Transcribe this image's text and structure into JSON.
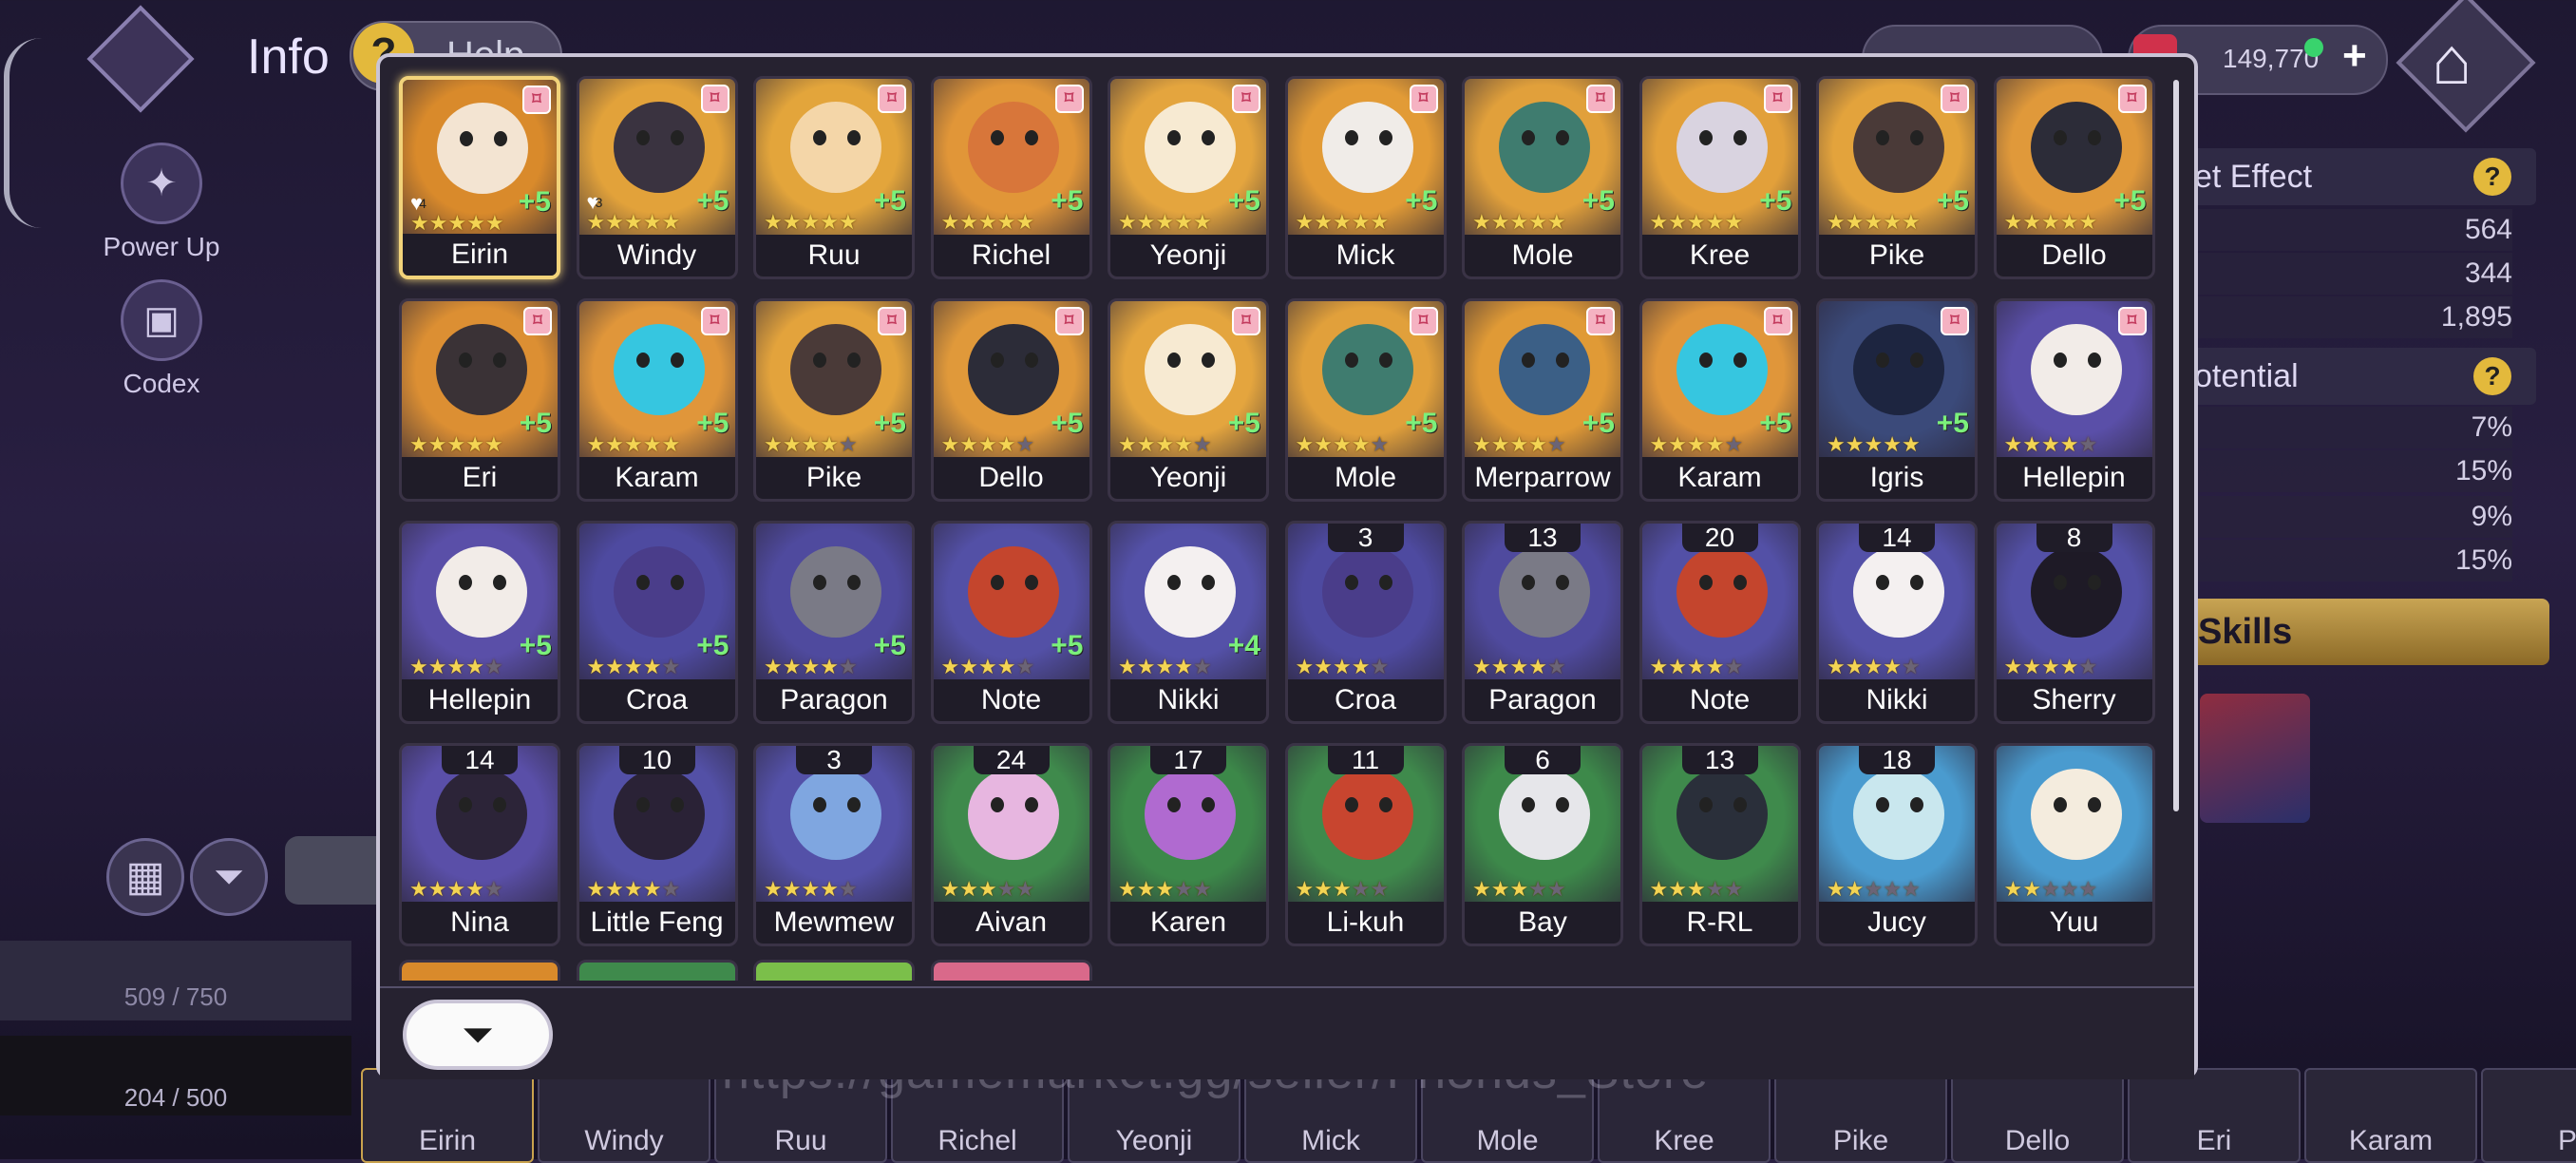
{
  "screen": {
    "title": "Info",
    "help_label": "Help",
    "side_nav": [
      {
        "label": "Power Up",
        "icon": "power-up-icon"
      },
      {
        "label": "Codex",
        "icon": "codex-icon"
      }
    ],
    "currency": {
      "value": "149,770",
      "plus": "+"
    },
    "right_panel": {
      "set_effect_label": "et Effect",
      "set_stats": [
        "564",
        "344",
        "1,895"
      ],
      "potential_label": "otential",
      "potential_stats": [
        "7%",
        "15%",
        "9%",
        "15%"
      ],
      "skills_label": "Skills"
    },
    "capacity": [
      {
        "label": "509 / 750"
      },
      {
        "label": "204 / 500"
      }
    ],
    "bottom_strip": [
      "Eirin",
      "Windy",
      "Ruu",
      "Richel",
      "Yeonji",
      "Mick",
      "Mole",
      "Kree",
      "Pike",
      "Dello",
      "Eri",
      "Karam",
      "P"
    ],
    "watermark": "https://gamemarket.gg/seller/Fri3nds_Store"
  },
  "modal": {
    "cards": [
      {
        "name": "Eirin",
        "stars": 5,
        "plus": "+5",
        "count": "",
        "heart": "4",
        "selected": true,
        "lock": true,
        "bg": "#d98a2b",
        "face": "#f3e4d2"
      },
      {
        "name": "Windy",
        "stars": 5,
        "plus": "+5",
        "count": "",
        "heart": "3",
        "selected": false,
        "lock": true,
        "bg": "#e2a23a",
        "face": "#3a3340"
      },
      {
        "name": "Ruu",
        "stars": 5,
        "plus": "+5",
        "count": "",
        "heart": "",
        "selected": false,
        "lock": true,
        "bg": "#e3a53b",
        "face": "#f4d6a8"
      },
      {
        "name": "Richel",
        "stars": 5,
        "plus": "+5",
        "count": "",
        "heart": "",
        "selected": false,
        "lock": true,
        "bg": "#e19638",
        "face": "#d8763a"
      },
      {
        "name": "Yeonji",
        "stars": 5,
        "plus": "+5",
        "count": "",
        "heart": "",
        "selected": false,
        "lock": true,
        "bg": "#e4a53e",
        "face": "#f7ead2"
      },
      {
        "name": "Mick",
        "stars": 5,
        "plus": "+5",
        "count": "",
        "heart": "",
        "selected": false,
        "lock": true,
        "bg": "#e29b36",
        "face": "#f0ece8"
      },
      {
        "name": "Mole",
        "stars": 5,
        "plus": "+5",
        "count": "",
        "heart": "",
        "selected": false,
        "lock": true,
        "bg": "#e1a03b",
        "face": "#3f7c6f"
      },
      {
        "name": "Kree",
        "stars": 5,
        "plus": "+5",
        "count": "",
        "heart": "",
        "selected": false,
        "lock": true,
        "bg": "#e2a03a",
        "face": "#d9d3e0"
      },
      {
        "name": "Pike",
        "stars": 5,
        "plus": "+5",
        "count": "",
        "heart": "",
        "selected": false,
        "lock": true,
        "bg": "#e3a33c",
        "face": "#4a3a38"
      },
      {
        "name": "Dello",
        "stars": 5,
        "plus": "+5",
        "count": "",
        "heart": "",
        "selected": false,
        "lock": true,
        "bg": "#e0993a",
        "face": "#2c2c38"
      },
      {
        "name": "Eri",
        "stars": 5,
        "plus": "+5",
        "count": "",
        "heart": "",
        "selected": false,
        "lock": true,
        "bg": "#dc8f33",
        "face": "#3a3236"
      },
      {
        "name": "Karam",
        "stars": 5,
        "plus": "+5",
        "count": "",
        "heart": "",
        "selected": false,
        "lock": true,
        "bg": "#e0963a",
        "face": "#36c6e0"
      },
      {
        "name": "Pike",
        "stars": 4,
        "plus": "+5",
        "count": "",
        "heart": "",
        "selected": false,
        "lock": true,
        "bg": "#e3a33c",
        "face": "#4a3a38"
      },
      {
        "name": "Dello",
        "stars": 4,
        "plus": "+5",
        "count": "",
        "heart": "",
        "selected": false,
        "lock": true,
        "bg": "#e0993a",
        "face": "#2c2c38"
      },
      {
        "name": "Yeonji",
        "stars": 4,
        "plus": "+5",
        "count": "",
        "heart": "",
        "selected": false,
        "lock": true,
        "bg": "#e4a53e",
        "face": "#f7ead2"
      },
      {
        "name": "Mole",
        "stars": 4,
        "plus": "+5",
        "count": "",
        "heart": "",
        "selected": false,
        "lock": true,
        "bg": "#e1a03b",
        "face": "#3f7c6f"
      },
      {
        "name": "Merparrow",
        "stars": 4,
        "plus": "+5",
        "count": "",
        "heart": "",
        "selected": false,
        "lock": true,
        "bg": "#e09a36",
        "face": "#3b5f86"
      },
      {
        "name": "Karam",
        "stars": 4,
        "plus": "+5",
        "count": "",
        "heart": "",
        "selected": false,
        "lock": true,
        "bg": "#e0963a",
        "face": "#36c6e0"
      },
      {
        "name": "Igris",
        "stars": 5,
        "plus": "+5",
        "count": "",
        "heart": "",
        "selected": false,
        "lock": true,
        "bg": "#3b4a7a",
        "face": "#1d2540"
      },
      {
        "name": "Hellepin",
        "stars": 4,
        "plus": "",
        "count": "",
        "heart": "",
        "selected": false,
        "lock": true,
        "bg": "#5a4fa8",
        "face": "#f2ece8"
      },
      {
        "name": "Hellepin",
        "stars": 4,
        "plus": "+5",
        "count": "",
        "heart": "",
        "selected": false,
        "lock": false,
        "bg": "#5a4fa8",
        "face": "#f2ece8"
      },
      {
        "name": "Croa",
        "stars": 4,
        "plus": "+5",
        "count": "",
        "heart": "",
        "selected": false,
        "lock": false,
        "bg": "#4e4aa0",
        "face": "#4a3d8a"
      },
      {
        "name": "Paragon",
        "stars": 4,
        "plus": "+5",
        "count": "",
        "heart": "",
        "selected": false,
        "lock": false,
        "bg": "#4f4a9e",
        "face": "#7a7a86"
      },
      {
        "name": "Note",
        "stars": 4,
        "plus": "+5",
        "count": "",
        "heart": "",
        "selected": false,
        "lock": false,
        "bg": "#5350a6",
        "face": "#c4452d"
      },
      {
        "name": "Nikki",
        "stars": 4,
        "plus": "+4",
        "count": "",
        "heart": "",
        "selected": false,
        "lock": false,
        "bg": "#5451a8",
        "face": "#f4f0f0"
      },
      {
        "name": "Croa",
        "stars": 4,
        "plus": "",
        "count": "3",
        "heart": "",
        "selected": false,
        "lock": false,
        "bg": "#4e4aa0",
        "face": "#4a3d8a"
      },
      {
        "name": "Paragon",
        "stars": 4,
        "plus": "",
        "count": "13",
        "heart": "",
        "selected": false,
        "lock": false,
        "bg": "#4f4a9e",
        "face": "#7a7a86"
      },
      {
        "name": "Note",
        "stars": 4,
        "plus": "",
        "count": "20",
        "heart": "",
        "selected": false,
        "lock": false,
        "bg": "#5350a6",
        "face": "#c4452d"
      },
      {
        "name": "Nikki",
        "stars": 4,
        "plus": "",
        "count": "14",
        "heart": "",
        "selected": false,
        "lock": false,
        "bg": "#5451a8",
        "face": "#f4f0f0"
      },
      {
        "name": "Sherry",
        "stars": 4,
        "plus": "",
        "count": "8",
        "heart": "",
        "selected": false,
        "lock": false,
        "bg": "#5350a6",
        "face": "#1e1a26"
      },
      {
        "name": "Nina",
        "stars": 4,
        "plus": "",
        "count": "14",
        "heart": "",
        "selected": false,
        "lock": false,
        "bg": "#5a4fa8",
        "face": "#2c2438"
      },
      {
        "name": "Little Feng",
        "stars": 4,
        "plus": "",
        "count": "10",
        "heart": "",
        "selected": false,
        "lock": false,
        "bg": "#5350a6",
        "face": "#2a2236"
      },
      {
        "name": "Mewmew",
        "stars": 4,
        "plus": "",
        "count": "3",
        "heart": "",
        "selected": false,
        "lock": false,
        "bg": "#5451a8",
        "face": "#7fa6e0"
      },
      {
        "name": "Aivan",
        "stars": 3,
        "plus": "",
        "count": "24",
        "heart": "",
        "selected": false,
        "lock": false,
        "bg": "#3f8a4c",
        "face": "#e7b6e0"
      },
      {
        "name": "Karen",
        "stars": 3,
        "plus": "",
        "count": "17",
        "heart": "",
        "selected": false,
        "lock": false,
        "bg": "#3c8849",
        "face": "#b06ad0"
      },
      {
        "name": "Li-kuh",
        "stars": 3,
        "plus": "",
        "count": "11",
        "heart": "",
        "selected": false,
        "lock": false,
        "bg": "#3f8a4c",
        "face": "#c8452f"
      },
      {
        "name": "Bay",
        "stars": 3,
        "plus": "",
        "count": "6",
        "heart": "",
        "selected": false,
        "lock": false,
        "bg": "#3d894a",
        "face": "#e6e6ea"
      },
      {
        "name": "R-RL",
        "stars": 3,
        "plus": "",
        "count": "13",
        "heart": "",
        "selected": false,
        "lock": false,
        "bg": "#3f8a4c",
        "face": "#2a2f3a"
      },
      {
        "name": "Jucy",
        "stars": 2,
        "plus": "",
        "count": "18",
        "heart": "",
        "selected": false,
        "lock": false,
        "bg": "#4a9bcf",
        "face": "#c9e7ee"
      },
      {
        "name": "Yuu",
        "stars": 2,
        "plus": "",
        "count": "",
        "heart": "",
        "selected": false,
        "lock": false,
        "bg": "#4a9bcf",
        "face": "#f4ecde"
      }
    ],
    "partial_row_colors": [
      "#d98a2b",
      "#3f8a4c",
      "#7bbf4a",
      "#d9698a"
    ],
    "filter_icon": "filter-icon"
  }
}
